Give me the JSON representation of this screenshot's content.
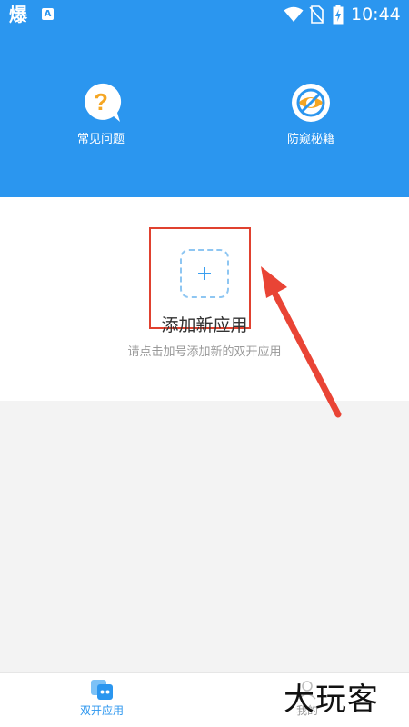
{
  "status_bar": {
    "app_icon_1": "爆",
    "app_icon_2": "A",
    "time": "10:44",
    "icons": [
      "wifi-icon",
      "no-sim-icon",
      "battery-charging-icon"
    ]
  },
  "header": {
    "items": [
      {
        "label": "常见问题",
        "icon": "question-bubble-icon",
        "icon_color": "#f5a623"
      },
      {
        "label": "防窥秘籍",
        "icon": "no-peek-eye-icon",
        "icon_color": "#f5a623"
      }
    ],
    "background_color": "#2b96ef"
  },
  "main": {
    "add_button_symbol": "+",
    "title": "添加新应用",
    "subtitle": "请点击加号添加新的双开应用"
  },
  "annotation": {
    "highlight_color": "#e0412f"
  },
  "bottom_nav": {
    "items": [
      {
        "label": "双开应用",
        "icon": "dual-app-icon",
        "active": true
      },
      {
        "label": "我的",
        "icon": "profile-icon",
        "active": false
      }
    ],
    "active_color": "#2b96ef"
  },
  "watermark": "大玩客"
}
